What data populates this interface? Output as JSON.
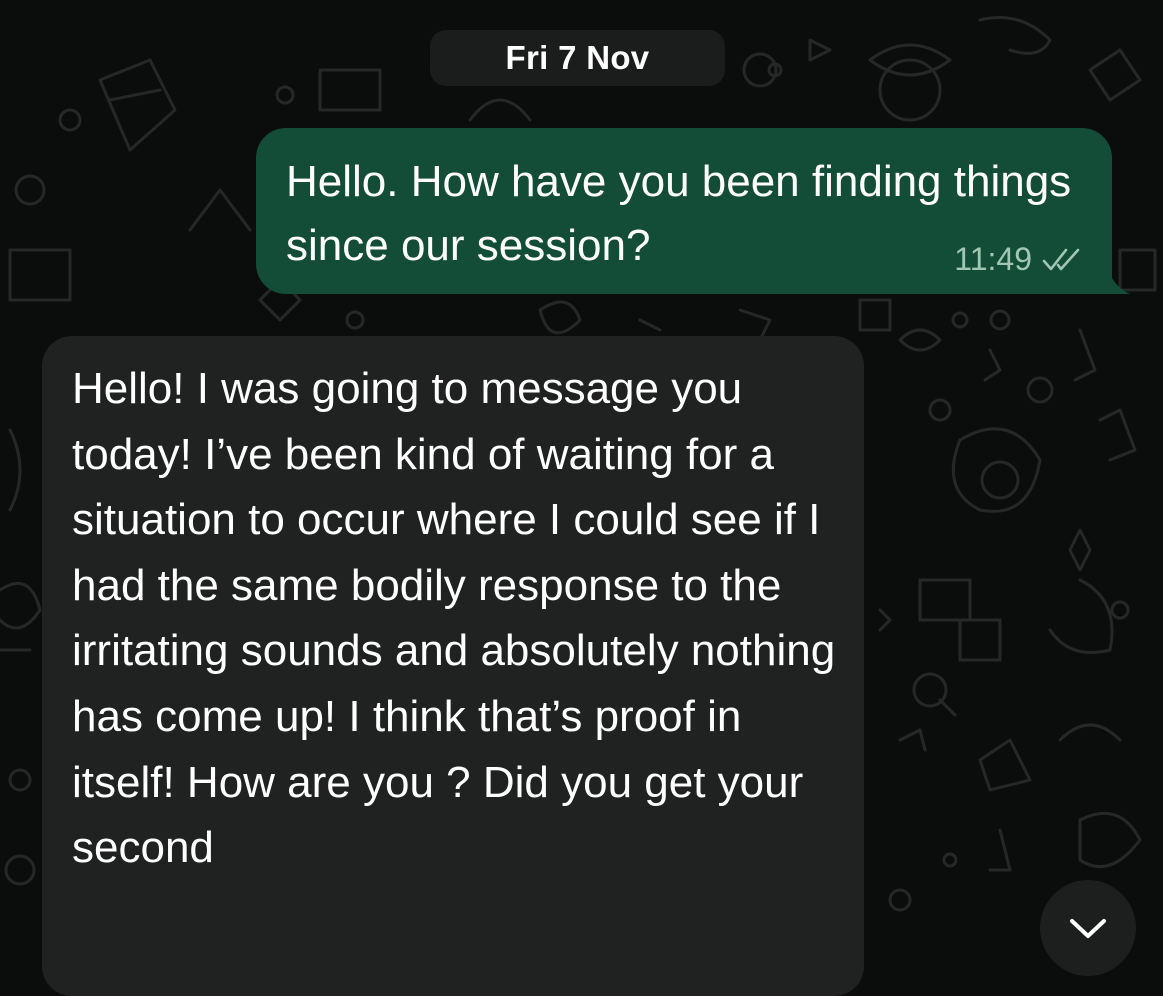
{
  "chat": {
    "date_separator": "Fri 7 Nov",
    "messages": [
      {
        "direction": "outgoing",
        "text": "Hello. How have you been finding things since our session?",
        "time": "11:49",
        "status_icon": "double-check-icon"
      },
      {
        "direction": "incoming",
        "text": "Hello! I was going to message you today! I’ve been kind of waiting for a situation to occur where I could see if I had the same bodily response to the irritating sounds and absolutely nothing has come up! I think that’s proof in itself! How are you ? Did you get your second"
      }
    ],
    "scroll_button_icon": "chevron-down-icon"
  },
  "colors": {
    "background": "#0b0c0c",
    "outgoing_bubble": "#144d37",
    "incoming_bubble": "#202222",
    "date_chip": "#1b1d1d",
    "meta_text": "#9fc7b4"
  }
}
